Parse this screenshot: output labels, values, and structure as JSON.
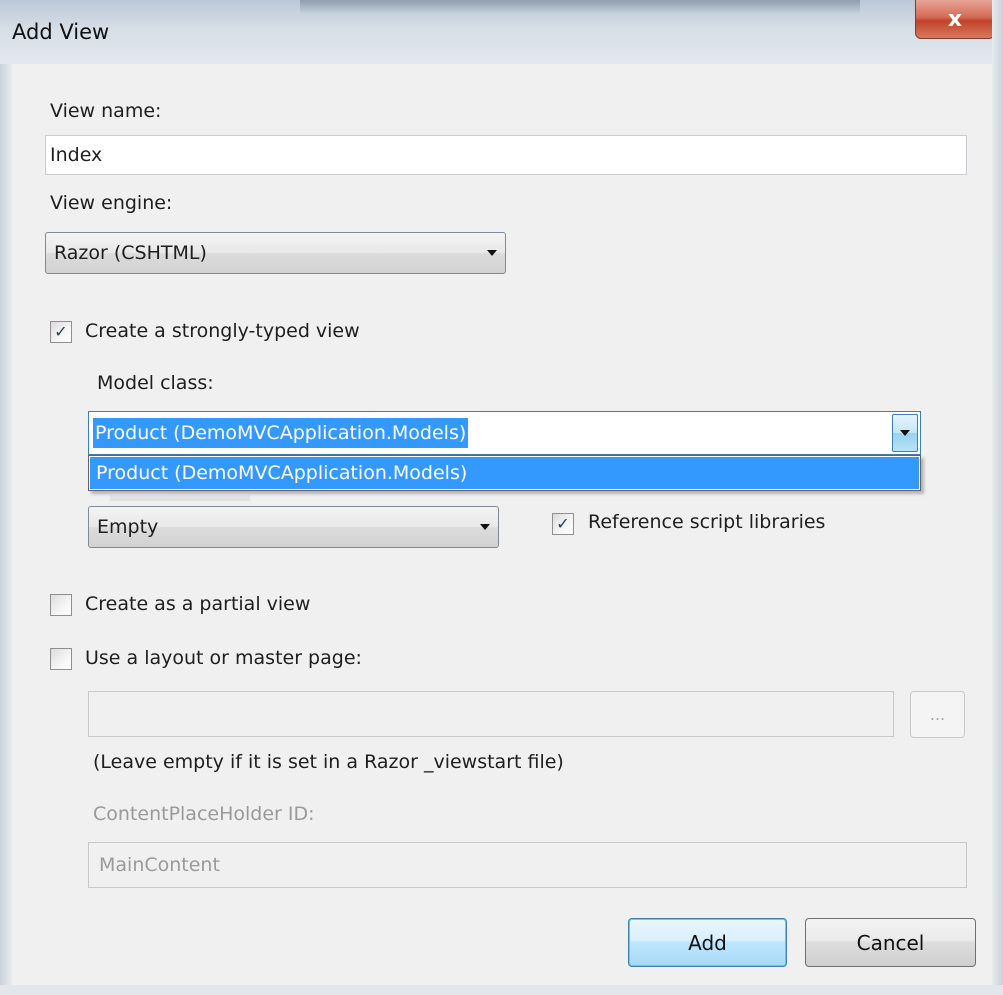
{
  "dialog": {
    "title": "Add View",
    "close_glyph": "x"
  },
  "view_name": {
    "label": "View name:",
    "value": "Index"
  },
  "view_engine": {
    "label": "View engine:",
    "selected": "Razor (CSHTML)"
  },
  "strongly_typed": {
    "label": "Create a strongly-typed view",
    "checked": true,
    "model_class_label": "Model class:",
    "model_class_value": "Product (DemoMVCApplication.Models)",
    "model_class_options": [
      "Product (DemoMVCApplication.Models)"
    ],
    "scaffold_selected": "Empty",
    "reference_scripts_label": "Reference script libraries",
    "reference_scripts_checked": true
  },
  "partial_view": {
    "label": "Create as a partial view",
    "checked": false
  },
  "layout": {
    "label": "Use a layout or master page:",
    "checked": false,
    "path_value": "",
    "browse_label": "...",
    "hint": "(Leave empty if it is set in a Razor _viewstart file)",
    "placeholder_id_label": "ContentPlaceHolder ID:",
    "placeholder_id_value": "MainContent"
  },
  "buttons": {
    "add": "Add",
    "cancel": "Cancel"
  },
  "colors": {
    "selection": "#3399ff",
    "dialog_bg": "#f0f0f0",
    "close_button": "#c2412a"
  },
  "icons": {
    "close": "close-icon",
    "dropdown": "chevron-down-icon",
    "checkmark": "checkmark-icon"
  }
}
